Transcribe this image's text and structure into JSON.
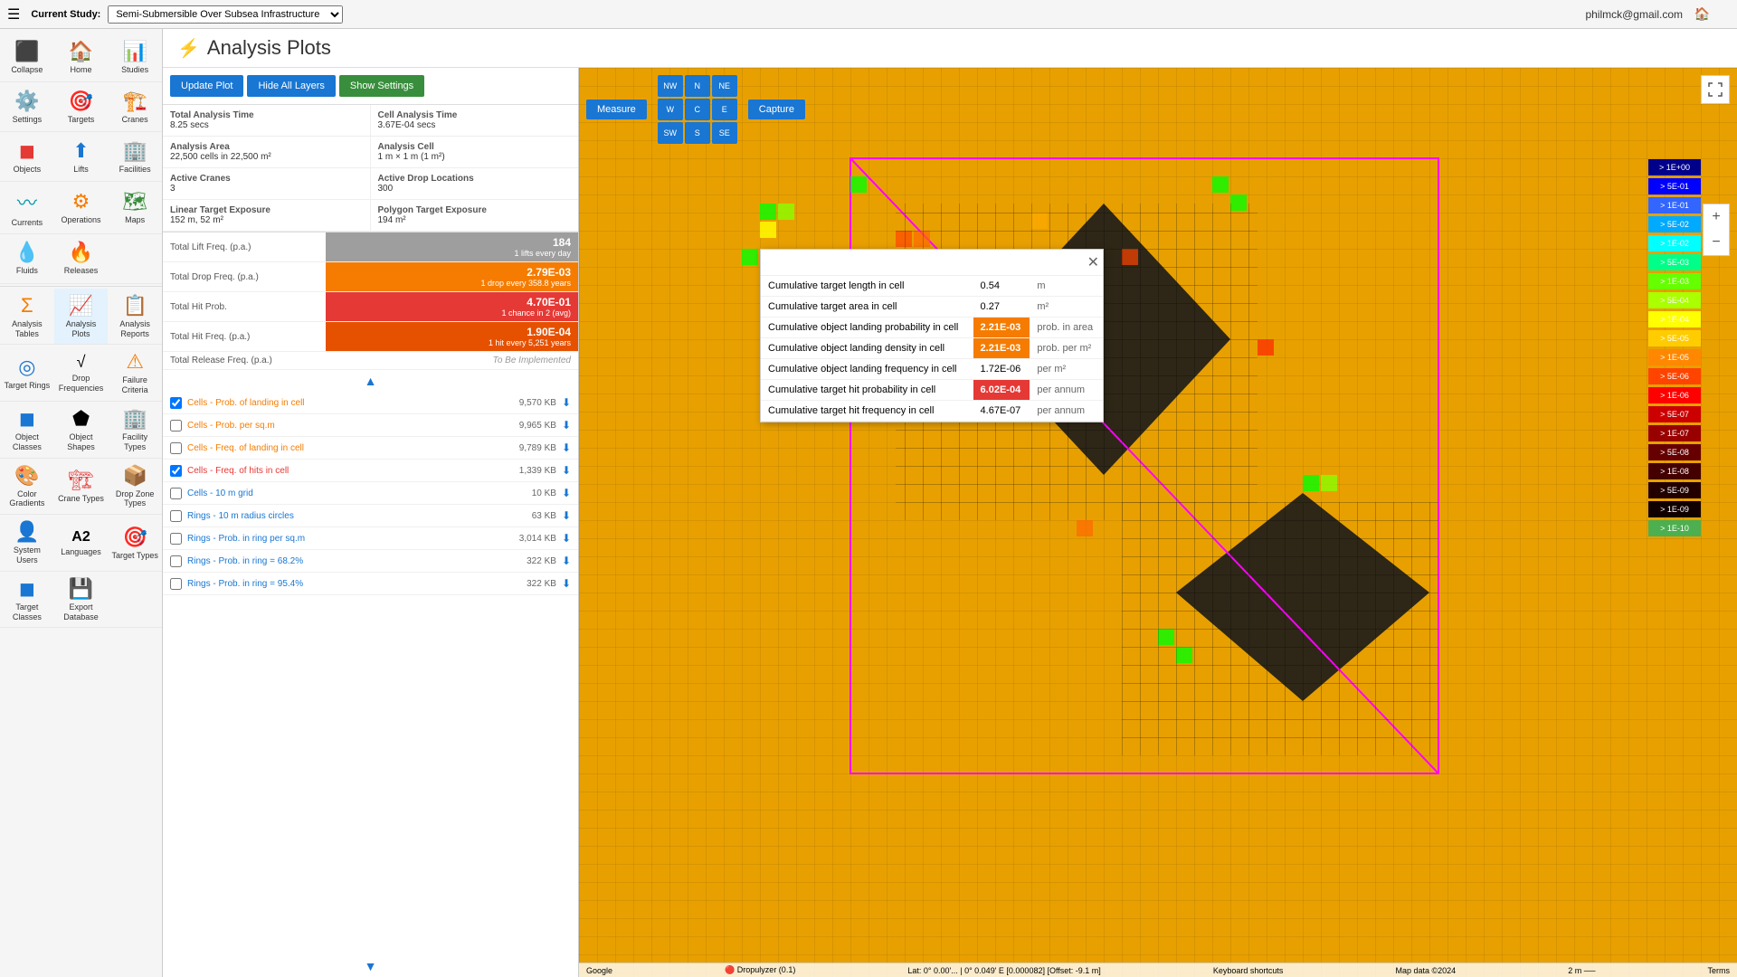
{
  "topbar": {
    "hamburger": "☰",
    "current_study_label": "Current Study:",
    "study_options": [
      "Semi-Submersible Over Subsea Infrastructure"
    ],
    "selected_study": "Semi-Submersible Over Subsea Infrastructure",
    "user_email": "philmck@gmail.com"
  },
  "sidebar": {
    "items": [
      {
        "id": "collapse",
        "icon": "⬛",
        "label": "Collapse",
        "color": "icon-blue"
      },
      {
        "id": "home",
        "icon": "🏠",
        "label": "Home",
        "color": "icon-blue"
      },
      {
        "id": "studies",
        "icon": "📊",
        "label": "Studies",
        "color": "icon-blue"
      },
      {
        "id": "settings",
        "icon": "⚙️",
        "label": "Settings",
        "color": ""
      },
      {
        "id": "targets",
        "icon": "🎯",
        "label": "Targets",
        "color": "icon-red"
      },
      {
        "id": "cranes",
        "icon": "🏗️",
        "label": "Cranes",
        "color": "icon-red"
      },
      {
        "id": "objects",
        "icon": "◼",
        "label": "Objects",
        "color": "icon-red"
      },
      {
        "id": "lifts",
        "icon": "⬆",
        "label": "Lifts",
        "color": "icon-blue"
      },
      {
        "id": "facilities",
        "icon": "🏢",
        "label": "Facilities",
        "color": "icon-green"
      },
      {
        "id": "currents",
        "icon": "〰",
        "label": "Currents",
        "color": "icon-cyan"
      },
      {
        "id": "operations",
        "icon": "⚙",
        "label": "Operations",
        "color": "icon-orange"
      },
      {
        "id": "maps",
        "icon": "🗺",
        "label": "Maps",
        "color": "icon-green"
      },
      {
        "id": "fluids",
        "icon": "💧",
        "label": "Fluids",
        "color": "icon-blue"
      },
      {
        "id": "releases",
        "icon": "🔥",
        "label": "Releases",
        "color": "icon-red"
      },
      {
        "id": "analysis-tables",
        "icon": "Σ",
        "label": "Analysis Tables",
        "color": "icon-orange"
      },
      {
        "id": "analysis-plots",
        "icon": "📈",
        "label": "Analysis Plots",
        "color": "icon-red"
      },
      {
        "id": "analysis-reports",
        "icon": "📋",
        "label": "Analysis Reports",
        "color": "icon-blue"
      },
      {
        "id": "target-rings",
        "icon": "◎",
        "label": "Target Rings",
        "color": "icon-blue"
      },
      {
        "id": "drop-frequencies",
        "icon": "√",
        "label": "Drop Frequencies",
        "color": ""
      },
      {
        "id": "failure-criteria",
        "icon": "⚠",
        "label": "Failure Criteria",
        "color": "icon-orange"
      },
      {
        "id": "object-classes",
        "icon": "◼",
        "label": "Object Classes",
        "color": "icon-blue"
      },
      {
        "id": "object-shapes",
        "icon": "⬟",
        "label": "Object Shapes",
        "color": ""
      },
      {
        "id": "facility-types",
        "icon": "🏢",
        "label": "Facility Types",
        "color": "icon-green"
      },
      {
        "id": "color-gradients",
        "icon": "🎨",
        "label": "Color Gradients",
        "color": "icon-blue"
      },
      {
        "id": "crane-types",
        "icon": "🏗",
        "label": "Crane Types",
        "color": "icon-red"
      },
      {
        "id": "drop-zone-types",
        "icon": "📦",
        "label": "Drop Zone Types",
        "color": "icon-orange"
      },
      {
        "id": "system-users",
        "icon": "👤",
        "label": "System Users",
        "color": "icon-blue"
      },
      {
        "id": "languages",
        "icon": "A2",
        "label": "Languages",
        "color": ""
      },
      {
        "id": "target-types",
        "icon": "🎯",
        "label": "Target Types",
        "color": "icon-blue"
      },
      {
        "id": "target-classes",
        "icon": "◼",
        "label": "Target Classes",
        "color": "icon-blue"
      },
      {
        "id": "export-database",
        "icon": "💾",
        "label": "Export Database",
        "color": "icon-blue"
      }
    ]
  },
  "page": {
    "logo": "⚡",
    "title": "Analysis Plots"
  },
  "plot_controls": {
    "update_plot": "Update Plot",
    "hide_all_layers": "Hide All Layers",
    "show_settings": "Show Settings"
  },
  "stats": [
    {
      "label": "Total Analysis Time",
      "value": "8.25 secs"
    },
    {
      "label": "Cell Analysis Time",
      "value": "3.67E-04 secs"
    },
    {
      "label": "Analysis Area",
      "value": "22,500 cells in 22,500 m²"
    },
    {
      "label": "Analysis Cell",
      "value": "1 m × 1 m (1 m²)"
    },
    {
      "label": "Active Cranes",
      "value": "3"
    },
    {
      "label": "Active Drop Locations",
      "value": "300"
    },
    {
      "label": "Linear Target Exposure",
      "value": "152 m, 52 m²"
    },
    {
      "label": "Polygon Target Exposure",
      "value": "194 m²"
    }
  ],
  "frequencies": [
    {
      "label": "Total Lift Freq. (p.a.)",
      "value": "184",
      "sub": "1 lifts every day",
      "color": "gray"
    },
    {
      "label": "Total Drop Freq. (p.a.)",
      "value": "2.79E-03",
      "sub": "1 drop every 358.8 years",
      "color": "orange"
    },
    {
      "label": "Total Hit Prob.",
      "value": "4.70E-01",
      "sub": "1 chance in 2 (avg)",
      "color": "red"
    },
    {
      "label": "Total Hit Freq. (p.a.)",
      "value": "1.90E-04",
      "sub": "1 hit every 5,251 years",
      "color": "dark-orange"
    }
  ],
  "total_release": {
    "label": "Total Release Freq. (p.a.)",
    "value": "To Be Implemented"
  },
  "layers": [
    {
      "checked": true,
      "name": "Cells - Prob. of landing in cell",
      "size": "9,570 KB",
      "color": "orange"
    },
    {
      "checked": false,
      "name": "Cells - Prob. per sq.m",
      "size": "9,965 KB",
      "color": "orange"
    },
    {
      "checked": false,
      "name": "Cells - Freq. of landing in cell",
      "size": "9,789 KB",
      "color": "orange"
    },
    {
      "checked": true,
      "name": "Cells - Freq. of hits in cell",
      "size": "1,339 KB",
      "color": "red"
    },
    {
      "checked": false,
      "name": "Cells - 10 m grid",
      "size": "10 KB",
      "color": "blue"
    },
    {
      "checked": false,
      "name": "Rings - 10 m radius circles",
      "size": "63 KB",
      "color": "blue"
    },
    {
      "checked": false,
      "name": "Rings - Prob. in ring per sq.m",
      "size": "3,014 KB",
      "color": "blue"
    },
    {
      "checked": false,
      "name": "Rings - Prob. in ring = 68.2%",
      "size": "322 KB",
      "color": "blue"
    },
    {
      "checked": false,
      "name": "Rings - Prob. in ring = 95.4%",
      "size": "322 KB",
      "color": "blue"
    }
  ],
  "map_toolbar": {
    "measure": "Measure",
    "capture": "Capture",
    "nav_buttons": [
      "NW",
      "N",
      "NE",
      "W",
      "C",
      "E",
      "SW",
      "S",
      "SE"
    ]
  },
  "legend": {
    "items": [
      "> 1E+00",
      "> 5E-01",
      "> 1E-01",
      "> 5E-02",
      "> 1E-02",
      "> 5E-03",
      "> 1E-03",
      "> 5E-04",
      "> 1E-04",
      "> 5E-05",
      "> 1E-05",
      "> 5E-06",
      "> 1E-06",
      "> 5E-07",
      "> 1E-07",
      "> 5E-08",
      "> 1E-08",
      "> 5E-09",
      "> 1E-09",
      "> 1E-10"
    ],
    "colors": [
      "#00008b",
      "#0000ff",
      "#0055ff",
      "#00aaff",
      "#00ffff",
      "#00ff88",
      "#00ff00",
      "#aaff00",
      "#ffff00",
      "#ffcc00",
      "#ff8800",
      "#ff4400",
      "#ff0000",
      "#cc0000",
      "#990000",
      "#660000",
      "#440000",
      "#220000",
      "#110000",
      "#4caf50"
    ]
  },
  "popup": {
    "rows": [
      {
        "label": "Cumulative target length in cell",
        "value": "0.54",
        "unit": "m",
        "highlight": ""
      },
      {
        "label": "Cumulative target area in cell",
        "value": "0.27",
        "unit": "m²",
        "highlight": ""
      },
      {
        "label": "Cumulative object landing probability in cell",
        "value": "2.21E-03",
        "unit": "prob. in area",
        "highlight": "orange"
      },
      {
        "label": "Cumulative object landing density in cell",
        "value": "2.21E-03",
        "unit": "prob. per m²",
        "highlight": "orange"
      },
      {
        "label": "Cumulative object landing frequency in cell",
        "value": "1.72E-06",
        "unit": "per m²",
        "highlight": ""
      },
      {
        "label": "Cumulative target hit probability in cell",
        "value": "6.02E-04",
        "unit": "per annum",
        "highlight": "red"
      },
      {
        "label": "Cumulative target hit frequency in cell",
        "value": "4.67E-07",
        "unit": "per annum",
        "highlight": ""
      }
    ]
  },
  "map_footer": {
    "google": "Google",
    "dropulyzer": "Dropulyzer (0.1)",
    "coordinates": "Lat: 0° 0.00'... | 0° 0.049' E [0.000082] [Offset: -9.1 m]",
    "keyboard": "Keyboard shortcuts",
    "map_data": "Map data ©2024",
    "scale": "2 m",
    "terms": "Terms"
  }
}
